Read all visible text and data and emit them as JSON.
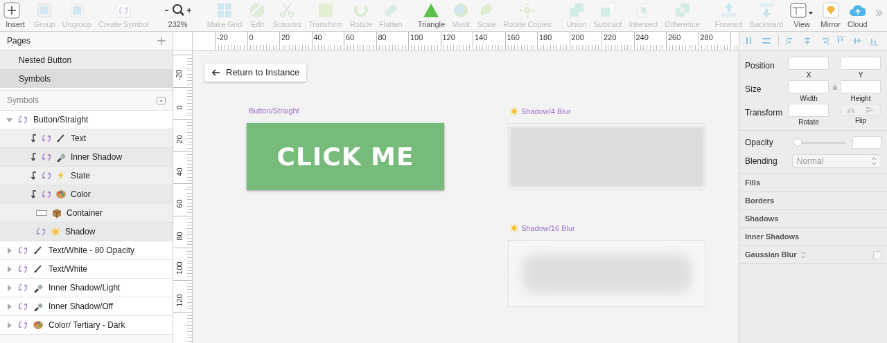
{
  "toolbar": [
    {
      "label": "Insert",
      "disabled": false
    },
    {
      "label": "Group",
      "disabled": true
    },
    {
      "label": "Ungroup",
      "disabled": true
    },
    {
      "label": "Create Symbol",
      "disabled": true
    },
    {
      "label": "232%",
      "disabled": false
    },
    {
      "label": "Make Grid",
      "disabled": true
    },
    {
      "label": "Edit",
      "disabled": true
    },
    {
      "label": "Scissors",
      "disabled": true
    },
    {
      "label": "Transform",
      "disabled": true
    },
    {
      "label": "Rotate",
      "disabled": true
    },
    {
      "label": "Flatten",
      "disabled": true
    },
    {
      "label": "Triangle",
      "disabled": false
    },
    {
      "label": "Mask",
      "disabled": true
    },
    {
      "label": "Scale",
      "disabled": true
    },
    {
      "label": "Rotate Copies",
      "disabled": true
    },
    {
      "label": "Union",
      "disabled": true
    },
    {
      "label": "Subtract",
      "disabled": true
    },
    {
      "label": "Intersect",
      "disabled": true
    },
    {
      "label": "Difference",
      "disabled": true
    },
    {
      "label": "Forward",
      "disabled": true
    },
    {
      "label": "Backward",
      "disabled": true
    },
    {
      "label": "View",
      "disabled": false
    },
    {
      "label": "Mirror",
      "disabled": false
    },
    {
      "label": "Cloud",
      "disabled": false
    }
  ],
  "pages": {
    "title": "Pages",
    "items": [
      {
        "label": "Nested Button",
        "selected": false
      },
      {
        "label": "Symbols",
        "selected": true
      }
    ]
  },
  "layers": {
    "title": "Symbols",
    "items": [
      {
        "label": "Button/Straight",
        "kind": "symbol",
        "expanded": true,
        "children": [
          {
            "label": "Text",
            "kind": "text",
            "clipped": true
          },
          {
            "label": "Inner Shadow",
            "kind": "torch",
            "clipped": true
          },
          {
            "label": "State",
            "kind": "bolt",
            "clipped": true
          },
          {
            "label": "Color",
            "kind": "palette",
            "clipped": true
          },
          {
            "label": "Container",
            "kind": "box",
            "clipped": false
          },
          {
            "label": "Shadow",
            "kind": "sun",
            "clipped": false
          }
        ]
      },
      {
        "label": "Text/White - 80 Opacity",
        "kind": "text",
        "expanded": false
      },
      {
        "label": "Text/White",
        "kind": "text",
        "expanded": false
      },
      {
        "label": "Inner Shadow/Light",
        "kind": "torch",
        "expanded": false
      },
      {
        "label": "Inner Shadow/Off",
        "kind": "torch",
        "expanded": false
      },
      {
        "label": "Color/ Tertiary - Dark",
        "kind": "palette",
        "expanded": false
      }
    ]
  },
  "ruler": {
    "x_labels": [
      "-20",
      "0",
      "20",
      "40",
      "60",
      "80",
      "100",
      "120",
      "140",
      "160",
      "180",
      "200",
      "220",
      "240",
      "260",
      "280"
    ],
    "y_labels": [
      "-20",
      "0",
      "20",
      "40",
      "60",
      "80",
      "100",
      "120"
    ]
  },
  "canvas": {
    "return_button": "Return to Instance",
    "artboards": [
      {
        "title": "Button/Straight",
        "kind": "button",
        "text": "CLICK ME"
      },
      {
        "title": "Shadow/4 Blur",
        "kind": "tight_shadow"
      },
      {
        "title": "Shadow/16 Blur",
        "kind": "soft_shadow"
      }
    ]
  },
  "inspector": {
    "fields": [
      {
        "label": "Position",
        "kind": "pair",
        "sub": [
          "X",
          "Y"
        ]
      },
      {
        "label": "Size",
        "kind": "locked_pair",
        "sub": [
          "Width",
          "Height"
        ]
      },
      {
        "label": "Transform",
        "kind": "flip",
        "sub": [
          "Rotate",
          "Flip"
        ]
      }
    ],
    "opacity": {
      "label": "Opacity",
      "level": 0
    },
    "blending": {
      "label": "Blending",
      "value": "Normal"
    },
    "sections": [
      {
        "label": "Fills",
        "kind": "plain"
      },
      {
        "label": "Borders",
        "kind": "plain"
      },
      {
        "label": "Shadows",
        "kind": "plain"
      },
      {
        "label": "Inner Shadows",
        "kind": "plain"
      },
      {
        "label": "Gaussian Blur",
        "kind": "toggle",
        "checked": false
      }
    ]
  }
}
